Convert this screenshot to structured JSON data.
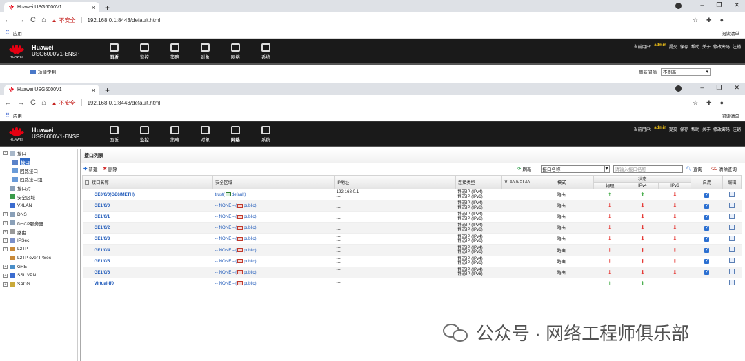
{
  "browser": {
    "tab_title": "Huawei USG6000V1",
    "new_tab": "+",
    "security_warning": "不安全",
    "url": "192.168.0.1:8443/default.html",
    "apps_label": "应用",
    "reading_list": "阅读清单",
    "window_controls": [
      "–",
      "❐",
      "✕"
    ]
  },
  "app": {
    "brand_name": "Huawei",
    "model": "USG6000V1-ENSP",
    "logo_text": "HUAWEI",
    "menu": [
      {
        "label": "面板",
        "icon": "dashboard-icon",
        "active": true
      },
      {
        "label": "监控",
        "icon": "monitor-icon",
        "active": false
      },
      {
        "label": "策略",
        "icon": "policy-icon",
        "active": false
      },
      {
        "label": "对象",
        "icon": "object-icon",
        "active": false
      },
      {
        "label": "网络",
        "icon": "network-icon",
        "active": true
      },
      {
        "label": "系统",
        "icon": "system-icon",
        "active": false
      }
    ],
    "user_prefix": "当前用户:",
    "user": "admin",
    "actions": [
      "提交",
      "保存",
      "帮助",
      "关于",
      "修改密码",
      "注销"
    ],
    "func_custom": "功能定制",
    "refresh_label": "刷新间隔",
    "refresh_value": "不刷新"
  },
  "sidebar": {
    "items": [
      {
        "label": "接口",
        "level": 0,
        "expand": "-",
        "selected": false
      },
      {
        "label": "接口",
        "level": 1,
        "expand": "",
        "selected": true
      },
      {
        "label": "回路接口",
        "level": 1,
        "expand": "",
        "selected": false
      },
      {
        "label": "回路接口组",
        "level": 1,
        "expand": "",
        "selected": false
      },
      {
        "label": "接口对",
        "level": 0,
        "expand": "",
        "selected": false
      },
      {
        "label": "安全区域",
        "level": 0,
        "expand": "",
        "selected": false
      },
      {
        "label": "VXLAN",
        "level": 0,
        "expand": "",
        "selected": false
      },
      {
        "label": "DNS",
        "level": 0,
        "expand": "+",
        "selected": false
      },
      {
        "label": "DHCP服务器",
        "level": 0,
        "expand": "+",
        "selected": false
      },
      {
        "label": "路由",
        "level": 0,
        "expand": "+",
        "selected": false
      },
      {
        "label": "IPSec",
        "level": 0,
        "expand": "+",
        "selected": false
      },
      {
        "label": "L2TP",
        "level": 0,
        "expand": "+",
        "selected": false
      },
      {
        "label": "L2TP over IPSec",
        "level": 0,
        "expand": "",
        "selected": false
      },
      {
        "label": "GRE",
        "level": 0,
        "expand": "+",
        "selected": false
      },
      {
        "label": "SSL VPN",
        "level": 0,
        "expand": "+",
        "selected": false
      },
      {
        "label": "SACG",
        "level": 0,
        "expand": "+",
        "selected": false
      }
    ]
  },
  "main": {
    "title": "接口列表",
    "new_btn": "新建",
    "delete_btn": "删除",
    "refresh_btn": "刷新",
    "filter_field": "接口名称",
    "search_placeholder": "请输入接口名称",
    "query_btn": "查询",
    "clear_btn": "清除查询",
    "columns": {
      "name": "接口名称",
      "zone": "安全区域",
      "ip": "IP地址",
      "conn": "连接类型",
      "vlan": "VLAN/VXLAN",
      "mode": "模式",
      "status": "状态",
      "phys": "物理",
      "ipv4": "IPv4",
      "ipv6": "IPv6",
      "enable": "启用",
      "edit": "编辑"
    },
    "rows": [
      {
        "name": "GE0/0/0(GE0/METH)",
        "zone_a": "trust(",
        "zone_b": "default)",
        "zone_icon": "g",
        "ip1": "192.168.0.1",
        "ip2": "---",
        "conn1": "静态IP (IPv4)",
        "conn2": "静态IP (IPv6)",
        "mode": "路由",
        "phys": "up",
        "ipv4": "up",
        "ipv6": "down",
        "enabled": true
      },
      {
        "name": "GE1/0/0",
        "zone_a": "-- NONE --(",
        "zone_b": "public)",
        "zone_icon": "r",
        "ip1": "---",
        "ip2": "---",
        "conn1": "静态IP (IPv4)",
        "conn2": "静态IP (IPv6)",
        "mode": "路由",
        "phys": "down",
        "ipv4": "down",
        "ipv6": "down",
        "enabled": true
      },
      {
        "name": "GE1/0/1",
        "zone_a": "-- NONE --(",
        "zone_b": "public)",
        "zone_icon": "r",
        "ip1": "---",
        "ip2": "---",
        "conn1": "静态IP (IPv4)",
        "conn2": "静态IP (IPv6)",
        "mode": "路由",
        "phys": "down",
        "ipv4": "down",
        "ipv6": "down",
        "enabled": true
      },
      {
        "name": "GE1/0/2",
        "zone_a": "-- NONE --(",
        "zone_b": "public)",
        "zone_icon": "r",
        "ip1": "---",
        "ip2": "---",
        "conn1": "静态IP (IPv4)",
        "conn2": "静态IP (IPv6)",
        "mode": "路由",
        "phys": "down",
        "ipv4": "down",
        "ipv6": "down",
        "enabled": true
      },
      {
        "name": "GE1/0/3",
        "zone_a": "-- NONE --(",
        "zone_b": "public)",
        "zone_icon": "r",
        "ip1": "---",
        "ip2": "---",
        "conn1": "静态IP (IPv4)",
        "conn2": "静态IP (IPv6)",
        "mode": "路由",
        "phys": "down",
        "ipv4": "down",
        "ipv6": "down",
        "enabled": true
      },
      {
        "name": "GE1/0/4",
        "zone_a": "-- NONE --(",
        "zone_b": "public)",
        "zone_icon": "r",
        "ip1": "---",
        "ip2": "---",
        "conn1": "静态IP (IPv4)",
        "conn2": "静态IP (IPv6)",
        "mode": "路由",
        "phys": "down",
        "ipv4": "down",
        "ipv6": "down",
        "enabled": true
      },
      {
        "name": "GE1/0/5",
        "zone_a": "-- NONE --(",
        "zone_b": "public)",
        "zone_icon": "r",
        "ip1": "---",
        "ip2": "---",
        "conn1": "静态IP (IPv4)",
        "conn2": "静态IP (IPv6)",
        "mode": "路由",
        "phys": "down",
        "ipv4": "down",
        "ipv6": "down",
        "enabled": true
      },
      {
        "name": "GE1/0/6",
        "zone_a": "-- NONE --(",
        "zone_b": "public)",
        "zone_icon": "r",
        "ip1": "---",
        "ip2": "---",
        "conn1": "静态IP (IPv4)",
        "conn2": "静态IP (IPv6)",
        "mode": "路由",
        "phys": "down",
        "ipv4": "down",
        "ipv6": "down",
        "enabled": true
      },
      {
        "name": "Virtual-if0",
        "zone_a": "-- NONE --(",
        "zone_b": "public)",
        "zone_icon": "r",
        "ip1": "---",
        "ip2": "",
        "conn1": "",
        "conn2": "",
        "mode": "",
        "phys": "up",
        "ipv4": "up",
        "ipv6": "",
        "enabled": false
      }
    ]
  },
  "watermark": "公众号 · 网络工程师俱乐部",
  "colors": {
    "accent": "#316ac5",
    "link": "#1a56b8",
    "up": "#4caf50",
    "down": "#e53935",
    "header": "#1a1a1a",
    "warning": "#c5221f"
  }
}
